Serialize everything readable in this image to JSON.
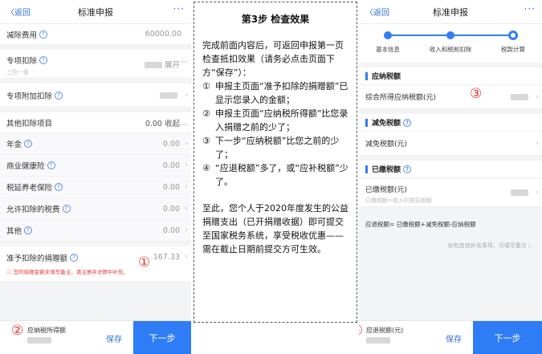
{
  "left": {
    "back": "〈返回",
    "title": "标准申报",
    "more": "···",
    "rows": {
      "jianchu": {
        "label": "减除费用",
        "value": "60000.00"
      },
      "zhuanxiang": {
        "label": "专项扣除",
        "sub": "三险一金",
        "value": "展开"
      },
      "fujia": {
        "label": "专项附加扣除"
      },
      "other": {
        "label": "其他扣除项目",
        "value": "0.00 收起"
      },
      "nianjin": {
        "label": "年金",
        "value": "0.00"
      },
      "jiankang": {
        "label": "商业健康险",
        "value": "0.00"
      },
      "yanglao": {
        "label": "税延养老保险",
        "value": "0.00"
      },
      "shuifei": {
        "label": "允许扣除的税费",
        "value": "0.00"
      },
      "qita": {
        "label": "其他",
        "value": "0.00"
      },
      "juanzeng": {
        "label": "准予扣除的捐赠额",
        "value": "167.33",
        "warn": "您的捐赠金额未填写备注，请注意并详情中补充。"
      }
    },
    "marker1": "①",
    "marker2": "②",
    "bottom": {
      "label": "应纳税所得额",
      "save": "保存",
      "next": "下一步"
    }
  },
  "center": {
    "heading": "第3步 检查效果",
    "intro": "完成前面内容后，可返回申报第一页检查抵扣效果（请务必点击页面下方“保存”）：",
    "items": [
      {
        "n": "①",
        "text": "申报主页面“准予扣除的捐赠额”已显示您录入的金额；"
      },
      {
        "n": "②",
        "text": "申报主页面“应纳税所得额”比您录入捐赠之前的少了；"
      },
      {
        "n": "③",
        "text": "下一步“应纳税额”比您之前的少了；"
      },
      {
        "n": "④",
        "text": "“应退税额”多了，或“应补税额”少了。"
      }
    ],
    "outro": "至此，您个人于2020年度发生的公益捐赠支出（已开捐赠收据）即可提交至国家税务系统，享受税收优惠——需在截止日期前提交方可生效。"
  },
  "right": {
    "back": "〈返回",
    "title": "标准申报",
    "more": "···",
    "steps": [
      "基本信息",
      "收入和税前扣除",
      "税款计算"
    ],
    "sections": {
      "yingna": {
        "title": "应纳税额",
        "label": "综合所得应纳税额(元)"
      },
      "jianmian": {
        "title": "减免税额",
        "label": "减免税额(元)"
      },
      "yijiao": {
        "title": "已缴税额",
        "label": "已缴税额(元)",
        "sub": "已缴税额=收入的预扣税额"
      }
    },
    "formula": "应退税额= 已缴税额+减免税额-应纳税额",
    "hint": "如有其他补充事项，可填写备注 〉",
    "marker3": "③",
    "marker4": "④",
    "bottom": {
      "label": "应退税额(元)",
      "save": "保存",
      "next": "下一步"
    }
  }
}
